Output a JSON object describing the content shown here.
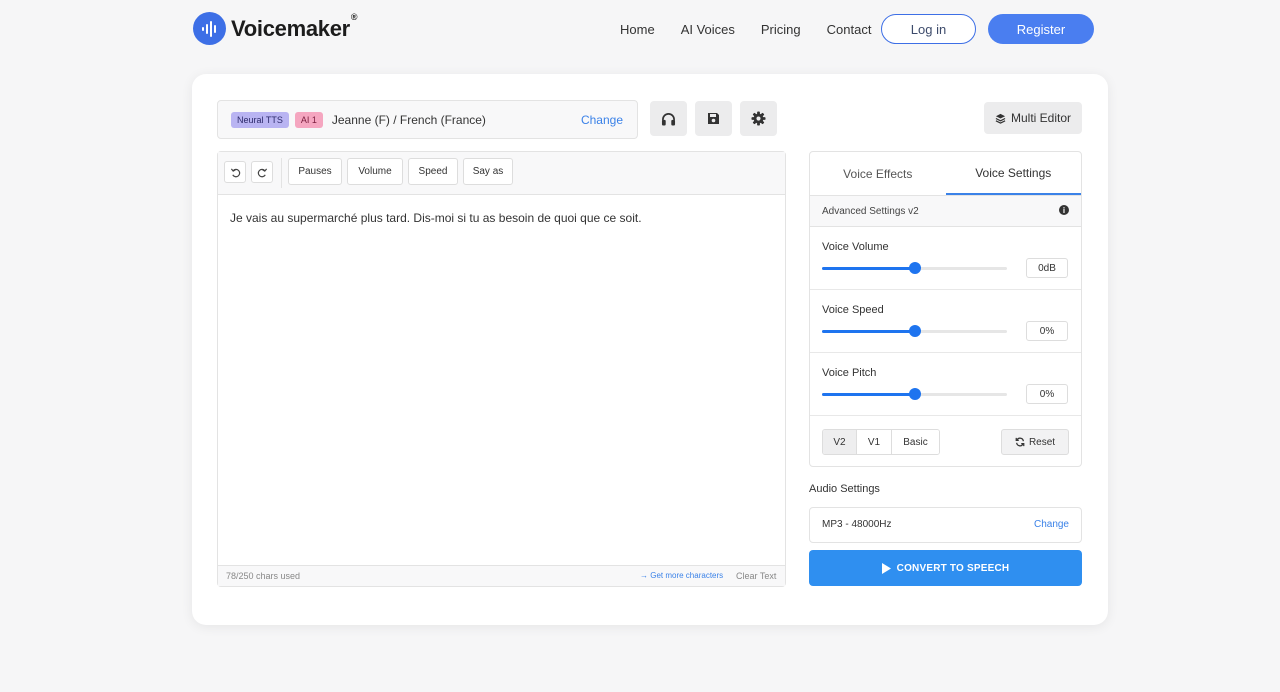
{
  "brand": {
    "name": "Voicemaker",
    "reg": "®"
  },
  "nav": {
    "items": [
      "Home",
      "AI Voices",
      "Pricing",
      "Contact"
    ],
    "login": "Log in",
    "register": "Register"
  },
  "voice": {
    "badge_engine": "Neural TTS",
    "badge_ai": "AI 1",
    "name": "Jeanne (F) / French (France)",
    "change": "Change"
  },
  "toolbar_icons": [
    "headphones-icon",
    "save-icon",
    "gear-icon"
  ],
  "multi_editor": "Multi Editor",
  "editor": {
    "buttons": [
      "Pauses",
      "Volume",
      "Speed",
      "Say as"
    ],
    "text": "Je vais au supermarché plus tard. Dis-moi si tu as besoin de quoi que ce soit.",
    "chars_used": "78/250 chars used",
    "get_more": "Get more characters",
    "clear": "Clear Text"
  },
  "settings": {
    "tabs": [
      "Voice Effects",
      "Voice Settings"
    ],
    "active_tab": 1,
    "advanced_label": "Advanced Settings v2",
    "sliders": [
      {
        "label": "Voice Volume",
        "value": "0dB",
        "position_pct": 50
      },
      {
        "label": "Voice Speed",
        "value": "0%",
        "position_pct": 50
      },
      {
        "label": "Voice Pitch",
        "value": "0%",
        "position_pct": 50
      }
    ],
    "versions": [
      "V2",
      "V1",
      "Basic"
    ],
    "active_version": 0,
    "reset": "Reset"
  },
  "audio": {
    "title": "Audio Settings",
    "format": "MP3 - 48000Hz",
    "change": "Change"
  },
  "convert": "CONVERT TO SPEECH",
  "colors": {
    "accent": "#3b82e8",
    "convert": "#2f8ff0",
    "register": "#4a7ef0",
    "slider": "#1e74ef"
  }
}
